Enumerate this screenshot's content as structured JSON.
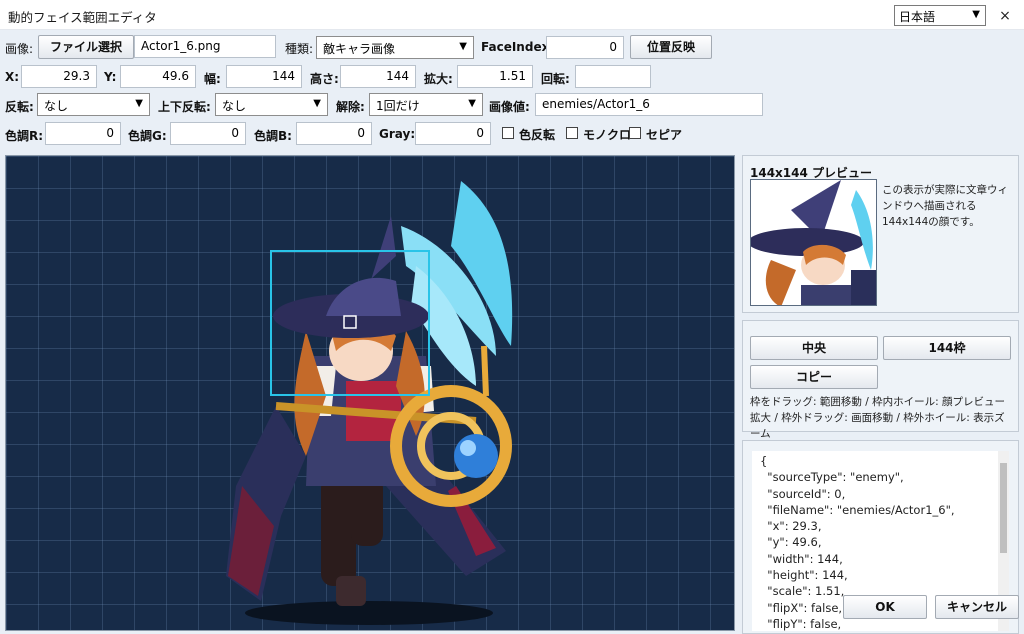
{
  "window": {
    "title": "動的フェイス範囲エディタ",
    "language": "日本語",
    "close": "×"
  },
  "row1": {
    "image_label": "画像:",
    "file_button": "ファイル選択",
    "file_name": "Actor1_6.png",
    "type_label": "種類:",
    "type_value": "敵キャラ画像",
    "faceindex_label": "FaceIndex:",
    "faceindex_value": "0",
    "apply_button": "位置反映"
  },
  "row2": {
    "x_label": "X:",
    "x_value": "29.3",
    "y_label": "Y:",
    "y_value": "49.6",
    "width_label": "幅:",
    "width_value": "144",
    "height_label": "高さ:",
    "height_value": "144",
    "scale_label": "拡大:",
    "scale_value": "1.51",
    "rotation_label": "回転:",
    "rotation_value": ""
  },
  "row3": {
    "flip_label": "反転:",
    "flip_value": "なし",
    "vflip_label": "上下反転:",
    "vflip_value": "なし",
    "release_label": "解除:",
    "release_value": "1回だけ",
    "imageval_label": "画像値:",
    "imageval_value": "enemies/Actor1_6"
  },
  "row4": {
    "r_label": "色調R:",
    "r_value": "0",
    "g_label": "色調G:",
    "g_value": "0",
    "b_label": "色調B:",
    "b_value": "0",
    "gray_label": "Gray:",
    "gray_value": "0",
    "invert_label": "色反転",
    "mono_label": "モノクロ",
    "sepia_label": "セピア"
  },
  "preview": {
    "title": "144x144 プレビュー",
    "description": "この表示が実際に文章ウィンドウへ描画される144x144の顔です。"
  },
  "buttons": {
    "center": "中央",
    "frame": "144枠",
    "copy": "コピー"
  },
  "hint": "枠をドラッグ: 範囲移動 / 枠内ホイール: 顔プレビュー拡大 / 枠外ドラッグ: 画面移動 / 枠外ホイール: 表示ズーム",
  "json_text": "{\n  \"sourceType\": \"enemy\",\n  \"sourceId\": 0,\n  \"fileName\": \"enemies/Actor1_6\",\n  \"x\": 29.3,\n  \"y\": 49.6,\n  \"width\": 144,\n  \"height\": 144,\n  \"scale\": 1.51,\n  \"flipX\": false,\n  \"flipY\": false,",
  "footer": {
    "ok": "OK",
    "cancel": "キャンセル"
  },
  "colors": {
    "canvas_bg": "#172b48",
    "frame": "#29c4e8",
    "panel": "#e9eff6"
  }
}
